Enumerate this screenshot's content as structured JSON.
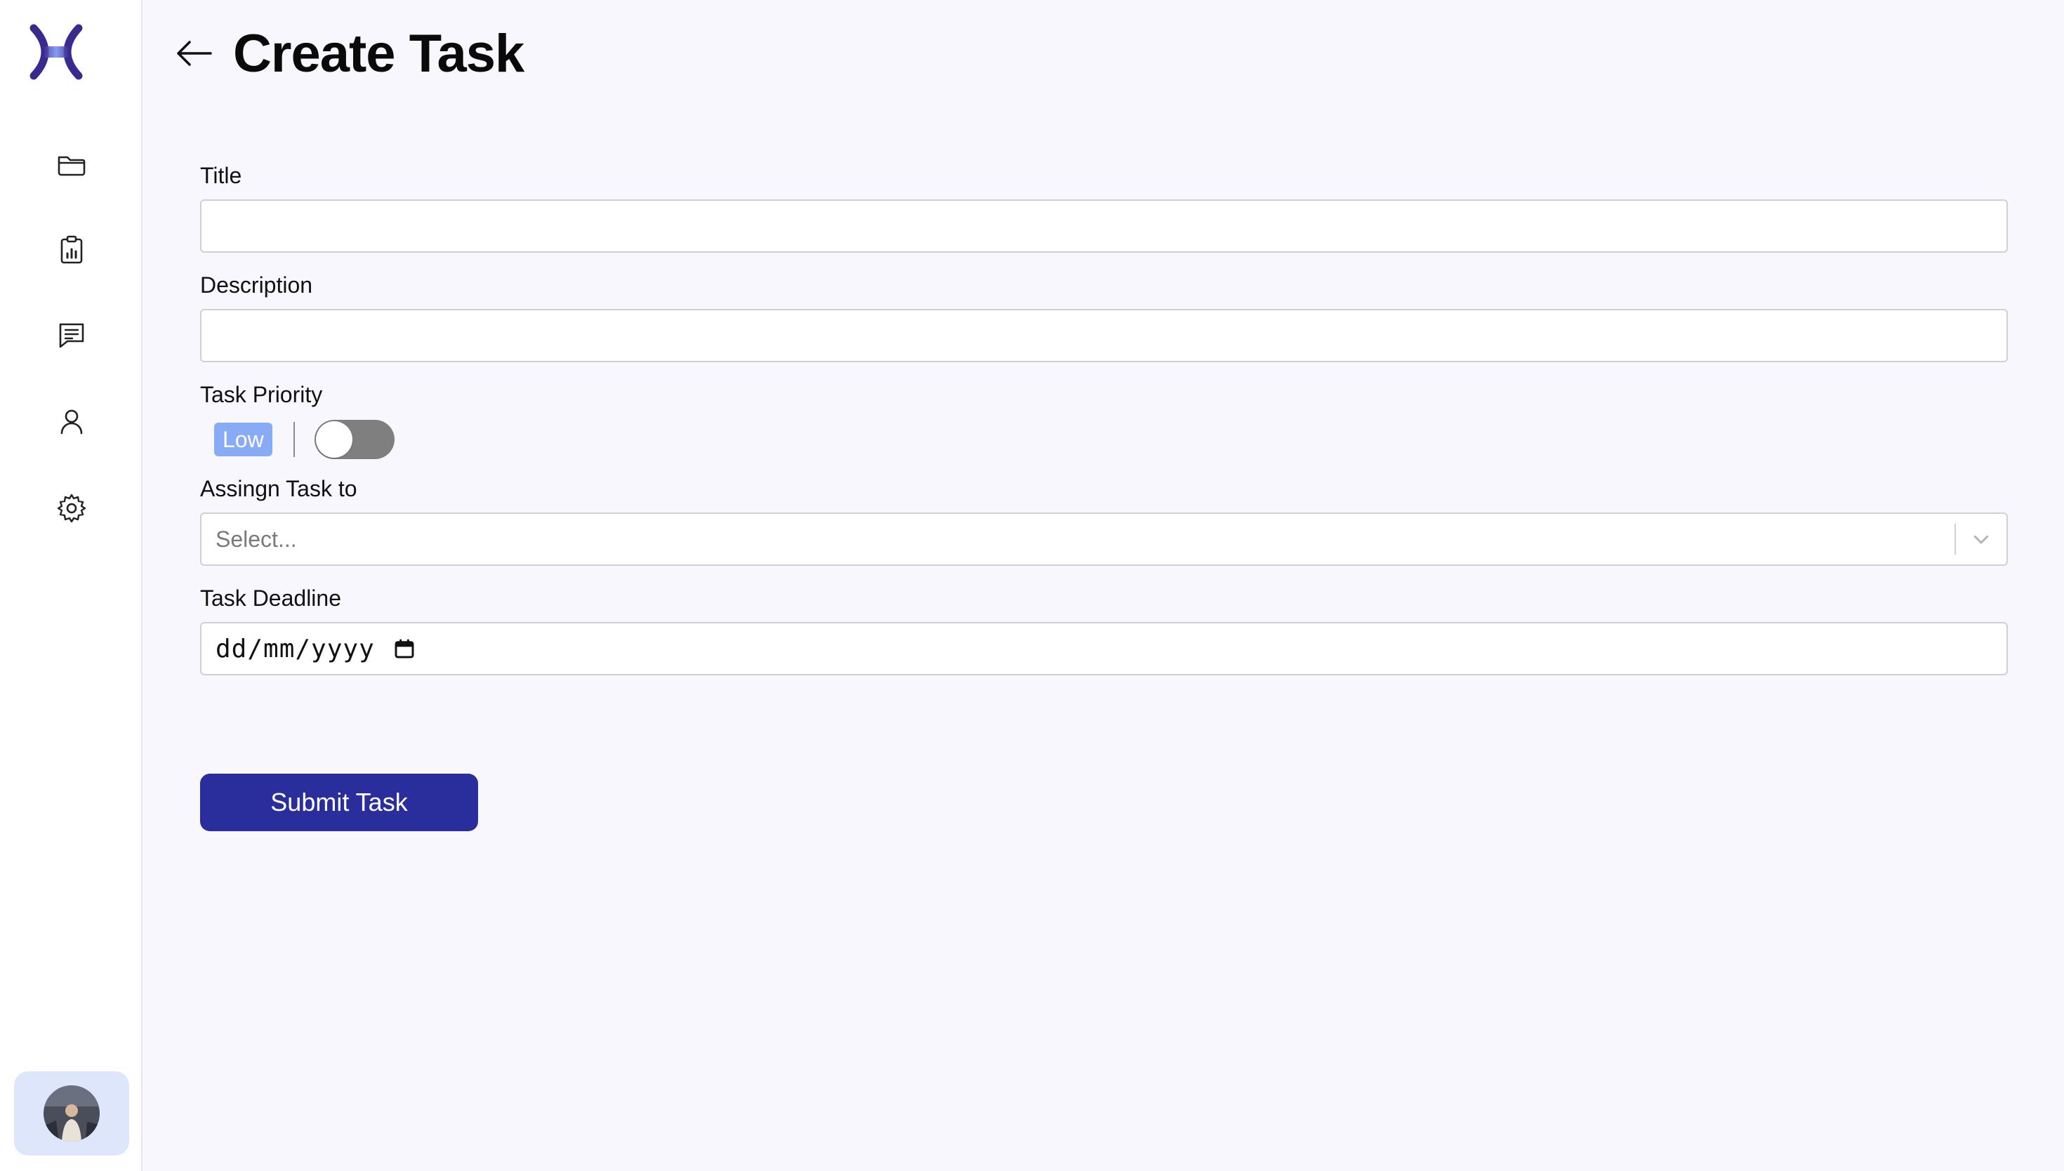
{
  "header": {
    "title": "Create Task"
  },
  "form": {
    "title_label": "Title",
    "title_value": "",
    "description_label": "Description",
    "description_value": "",
    "priority_label": "Task Priority",
    "priority_value": "Low",
    "priority_toggle_on": false,
    "assign_label": "Assingn Task to",
    "assign_placeholder": "Select...",
    "deadline_label": "Task Deadline",
    "deadline_placeholder": "dd/mm/yyyy",
    "submit_label": "Submit Task"
  },
  "sidebar": {
    "items": [
      {
        "icon": "folder-icon"
      },
      {
        "icon": "clipboard-chart-icon"
      },
      {
        "icon": "chat-icon"
      },
      {
        "icon": "user-icon"
      },
      {
        "icon": "gear-icon"
      }
    ]
  },
  "colors": {
    "accent": "#2a2e9c",
    "priority_badge": "#87acf5",
    "background": "#f7f7fd",
    "toggle_off": "#7f7f7f"
  }
}
